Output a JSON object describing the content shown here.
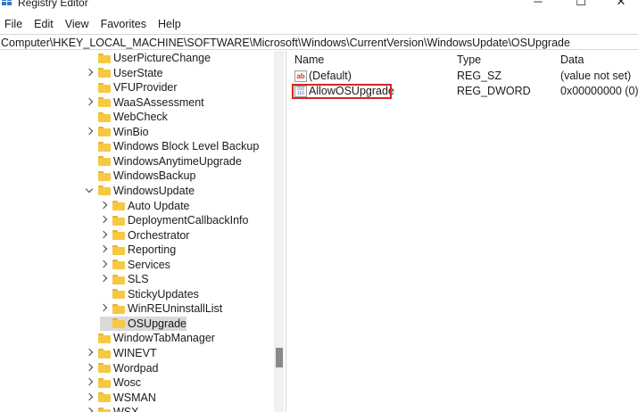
{
  "window": {
    "title": "Registry Editor"
  },
  "menu": [
    "File",
    "Edit",
    "View",
    "Favorites",
    "Help"
  ],
  "address": "Computer\\HKEY_LOCAL_MACHINE\\SOFTWARE\\Microsoft\\Windows\\CurrentVersion\\WindowsUpdate\\OSUpgrade",
  "tree": [
    {
      "label": "UserPictureChange",
      "expander": "none",
      "selected": false
    },
    {
      "label": "UserState",
      "expander": "collapsed",
      "selected": false
    },
    {
      "label": "VFUProvider",
      "expander": "none",
      "selected": false
    },
    {
      "label": "WaaSAssessment",
      "expander": "collapsed",
      "selected": false
    },
    {
      "label": "WebCheck",
      "expander": "none",
      "selected": false
    },
    {
      "label": "WinBio",
      "expander": "collapsed",
      "selected": false
    },
    {
      "label": "Windows Block Level Backup",
      "expander": "none",
      "selected": false
    },
    {
      "label": "WindowsAnytimeUpgrade",
      "expander": "none",
      "selected": false
    },
    {
      "label": "WindowsBackup",
      "expander": "none",
      "selected": false
    },
    {
      "label": "WindowsUpdate",
      "expander": "expanded",
      "selected": false
    },
    {
      "label": "Auto Update",
      "expander": "collapsed",
      "selected": false
    },
    {
      "label": "DeploymentCallbackInfo",
      "expander": "collapsed",
      "selected": false
    },
    {
      "label": "Orchestrator",
      "expander": "collapsed",
      "selected": false
    },
    {
      "label": "Reporting",
      "expander": "collapsed",
      "selected": false
    },
    {
      "label": "Services",
      "expander": "collapsed",
      "selected": false
    },
    {
      "label": "SLS",
      "expander": "collapsed",
      "selected": false
    },
    {
      "label": "StickyUpdates",
      "expander": "none",
      "selected": false
    },
    {
      "label": "WinREUninstallList",
      "expander": "collapsed",
      "selected": false
    },
    {
      "label": "OSUpgrade",
      "expander": "none",
      "selected": true
    },
    {
      "label": "WindowTabManager",
      "expander": "none",
      "selected": false
    },
    {
      "label": "WINEVT",
      "expander": "collapsed",
      "selected": false
    },
    {
      "label": "Wordpad",
      "expander": "collapsed",
      "selected": false
    },
    {
      "label": "Wosc",
      "expander": "collapsed",
      "selected": false
    },
    {
      "label": "WSMAN",
      "expander": "collapsed",
      "selected": false
    },
    {
      "label": "WSX",
      "expander": "collapsed",
      "selected": false
    }
  ],
  "list": {
    "columns": [
      "Name",
      "Type",
      "Data"
    ],
    "rows": [
      {
        "name": "(Default)",
        "type": "REG_SZ",
        "data": "(value not set)",
        "icon": "string-value-icon"
      },
      {
        "name": "AllowOSUpgrade",
        "type": "REG_DWORD",
        "data": "0x00000000 (0)",
        "icon": "dword-value-icon"
      }
    ]
  },
  "accent": "#dd2222"
}
